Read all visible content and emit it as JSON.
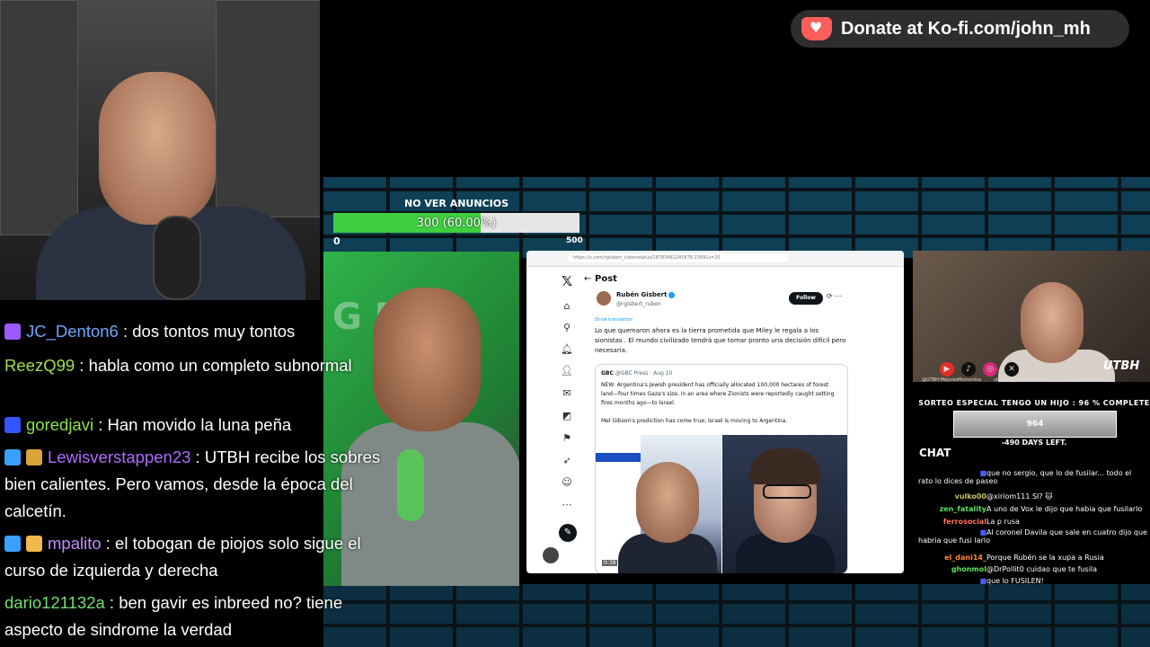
{
  "donate": {
    "text": "Donate at Ko-fi.com/john_mh",
    "icon": "kofi-cup-icon",
    "color": "#ff5e5b"
  },
  "progress": {
    "title": "NO VER ANUNCIOS",
    "label": "300 (60.00%)",
    "fraction": 0.6,
    "min": "0",
    "max": "500",
    "fill_color": "#3fcf3f"
  },
  "browser": {
    "url": "https://x.com/rgisbert_rubenstatus/18783462245878 15891s=20",
    "header": "Post",
    "author_name": "Rubén Gisbert",
    "author_handle": "@rgisbert_ruben",
    "follow_label": "Follow",
    "show_translation": "Show translation",
    "tweet_text": "Lo que quemaron ahora es la tierra prometida que Miley le regala a los sionistas . El mundo civilizado tendrá que tomar pronto una decisión difícil pero necesaria.",
    "quote": {
      "name": "GBC",
      "handle": "@GBC Press · Aug 10",
      "text": "NEW: Argentina's Jewish president has officially allocated 100,000 hectares of forest land—four times Gaza's size, in an area where Zionists were reportedly caught setting fires months ago—to Israel.",
      "text2": "Mel Gibson's prediction has come true; Israel is moving to Argentina."
    },
    "video_time": "0:38",
    "nav_icons": [
      "home-icon",
      "search-icon",
      "bell-icon",
      "person-add-icon",
      "message-icon",
      "grok-icon",
      "bookmark-icon",
      "rocket-icon",
      "profile-icon",
      "more-icon"
    ]
  },
  "rightcam": {
    "social": [
      "@UTBH-MejoresMomentos",
      "utbhmejoresmomentos",
      "@UTBHmomentos"
    ],
    "logo": "UTBH"
  },
  "sorteo": {
    "title": "SORTEO ESPECIAL TENGO UN HIJO : 96 % COMPLETE",
    "value": "964",
    "days": "-490 DAYS LEFT."
  },
  "mini_chat": {
    "title": "CHAT",
    "messages": [
      {
        "user": "",
        "text": "que no sergio, que lo de fusilar... todo el rato lo dices de paseo",
        "color": "#4b5cff"
      },
      {
        "user": "vulko00",
        "text": "@xiriom111 SI? 🐱",
        "color": "#c9c36a"
      },
      {
        "user": "zen_fatality",
        "text": "A uno de Vox le dijo que habia que fusilarlo",
        "color": "#60e060"
      },
      {
        "user": "ferrosocial",
        "text": "La p rusa",
        "color": "#ff7060"
      },
      {
        "user": "",
        "text": "Al coronel Davila que sale en cuatro dijo que habria que fusi larlo",
        "color": "#4b5cff"
      },
      {
        "user": "el_dani14_",
        "text": "Porque Rubén se la xupa a Rusia",
        "color": "#ff8a3a"
      },
      {
        "user": "ghonmol",
        "text": "@DrPollit0 cuidao que te fusila",
        "color": "#60e060"
      },
      {
        "user": "",
        "text": "que lo FUSILEN!",
        "color": "#4b5cff"
      }
    ]
  },
  "chat": {
    "messages": [
      {
        "badges": [
          "star-badge-icon"
        ],
        "user": "JC_Denton6",
        "text": " : dos tontos muy tontos",
        "color": "#6aa7ff"
      },
      {
        "badges": [],
        "user": "ReezQ99",
        "text": " : habla como un completo subnormal",
        "color": "#9ee04a"
      },
      {
        "badges": [
          "game-badge-icon"
        ],
        "user": "goredjavi",
        "text": " : Han movido la luna peña",
        "color": "#8ee04a"
      },
      {
        "badges": [
          "cube-badge-icon",
          "chest-badge-icon"
        ],
        "user": "Lewisverstappen23",
        "text": " : UTBH recibe los sobres bien calientes. Pero vamos, desde la época del calcetín.",
        "color": "#b06cff"
      },
      {
        "badges": [
          "cube-badge-icon",
          "warning-badge-icon"
        ],
        "user": "mpalito",
        "text": " : el tobogan de piojos solo sigue el curso de izquierda y derecha",
        "color": "#c48cff"
      },
      {
        "badges": [],
        "user": "dario121132a",
        "text": " : ben gavir es inbreed no? tiene aspecto de sindrome la verdad",
        "color": "#6fe06f"
      }
    ]
  }
}
